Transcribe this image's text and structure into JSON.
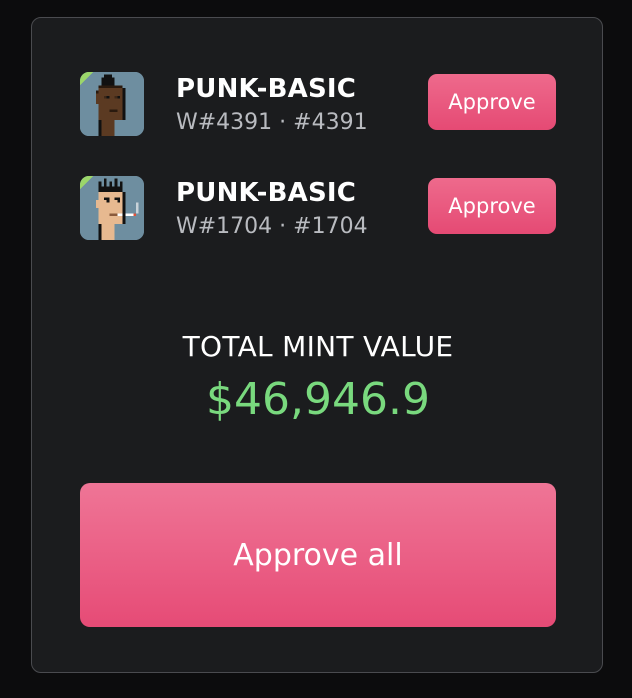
{
  "items": [
    {
      "name": "PUNK-BASIC",
      "subtitle": "W#4391 · #4391",
      "button_label": "Approve",
      "avatar_icon": "punk-avatar-mohawk-icon"
    },
    {
      "name": "PUNK-BASIC",
      "subtitle": "W#1704 · #1704",
      "button_label": "Approve",
      "avatar_icon": "punk-avatar-cigarette-icon"
    }
  ],
  "total": {
    "label": "TOTAL MINT VALUE",
    "value": "$46,946.9"
  },
  "approve_all_label": "Approve all",
  "colors": {
    "accent": "#e64b76",
    "value_green": "#79d97e",
    "panel_bg": "#1b1c1e"
  }
}
